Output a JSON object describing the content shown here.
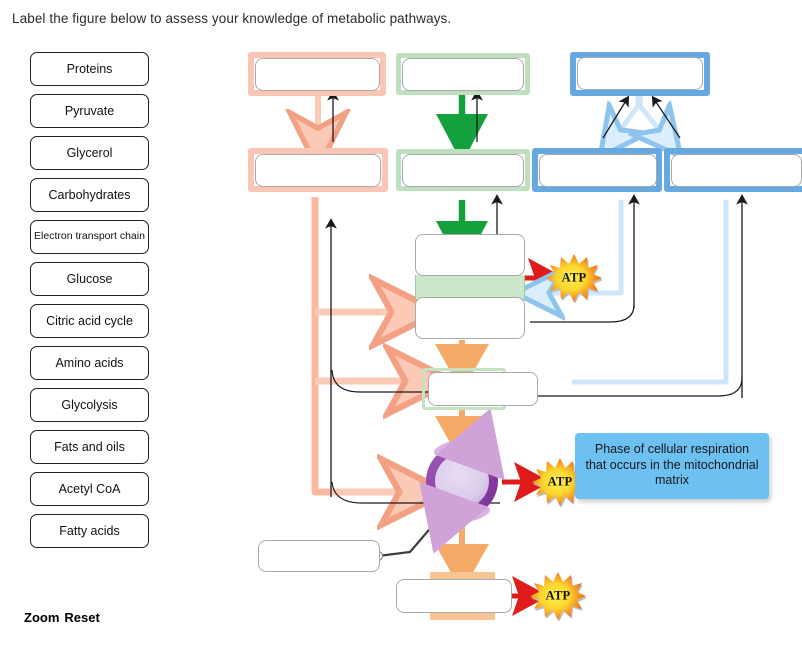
{
  "prompt": "Label the figure below to assess your knowledge of metabolic pathways.",
  "label_bank": {
    "items": [
      {
        "label": "Proteins"
      },
      {
        "label": "Pyruvate"
      },
      {
        "label": "Glycerol"
      },
      {
        "label": "Carbohydrates"
      },
      {
        "label": "Electron transport chain"
      },
      {
        "label": "Glucose"
      },
      {
        "label": "Citric acid cycle"
      },
      {
        "label": "Amino acids"
      },
      {
        "label": "Glycolysis"
      },
      {
        "label": "Fats and oils"
      },
      {
        "label": "Acetyl CoA"
      },
      {
        "label": "Fatty acids"
      }
    ]
  },
  "controls": {
    "zoom_label": "Zoom",
    "reset_label": "Reset"
  },
  "figure": {
    "drop_zones": [
      {
        "id": "dz-1",
        "value": "",
        "highlight": "salmon"
      },
      {
        "id": "dz-2",
        "value": "",
        "highlight": "green"
      },
      {
        "id": "dz-3",
        "value": "",
        "highlight": "blue"
      },
      {
        "id": "dz-4",
        "value": "",
        "highlight": "salmon"
      },
      {
        "id": "dz-5",
        "value": "",
        "highlight": "green"
      },
      {
        "id": "dz-6",
        "value": "",
        "highlight": "blue"
      },
      {
        "id": "dz-7",
        "value": "",
        "highlight": "blue"
      },
      {
        "id": "dz-8",
        "value": "",
        "highlight": "none"
      },
      {
        "id": "dz-9",
        "value": "",
        "highlight": "none"
      },
      {
        "id": "dz-10",
        "value": "",
        "highlight": "green-thin"
      },
      {
        "id": "dz-11",
        "value": "",
        "highlight": "none"
      },
      {
        "id": "dz-12",
        "value": "",
        "highlight": "none"
      }
    ],
    "atp_markers": [
      {
        "id": "atp-glycolysis",
        "label": "ATP"
      },
      {
        "id": "atp-citric-acid-cycle",
        "label": "ATP"
      },
      {
        "id": "atp-electron-transport-chain",
        "label": "ATP"
      }
    ],
    "tooltip": {
      "text": "Phase of cellular respiration that occurs in the mitochondrial matrix"
    },
    "colors": {
      "salmon": "#f9a98c",
      "green": "#14a03c",
      "blue": "#9fd0f5",
      "orange": "#f5ab67",
      "red": "#e01b1b",
      "mito_ring": "#8e4fa8",
      "tooltip_bg": "#6cc0f2"
    }
  }
}
